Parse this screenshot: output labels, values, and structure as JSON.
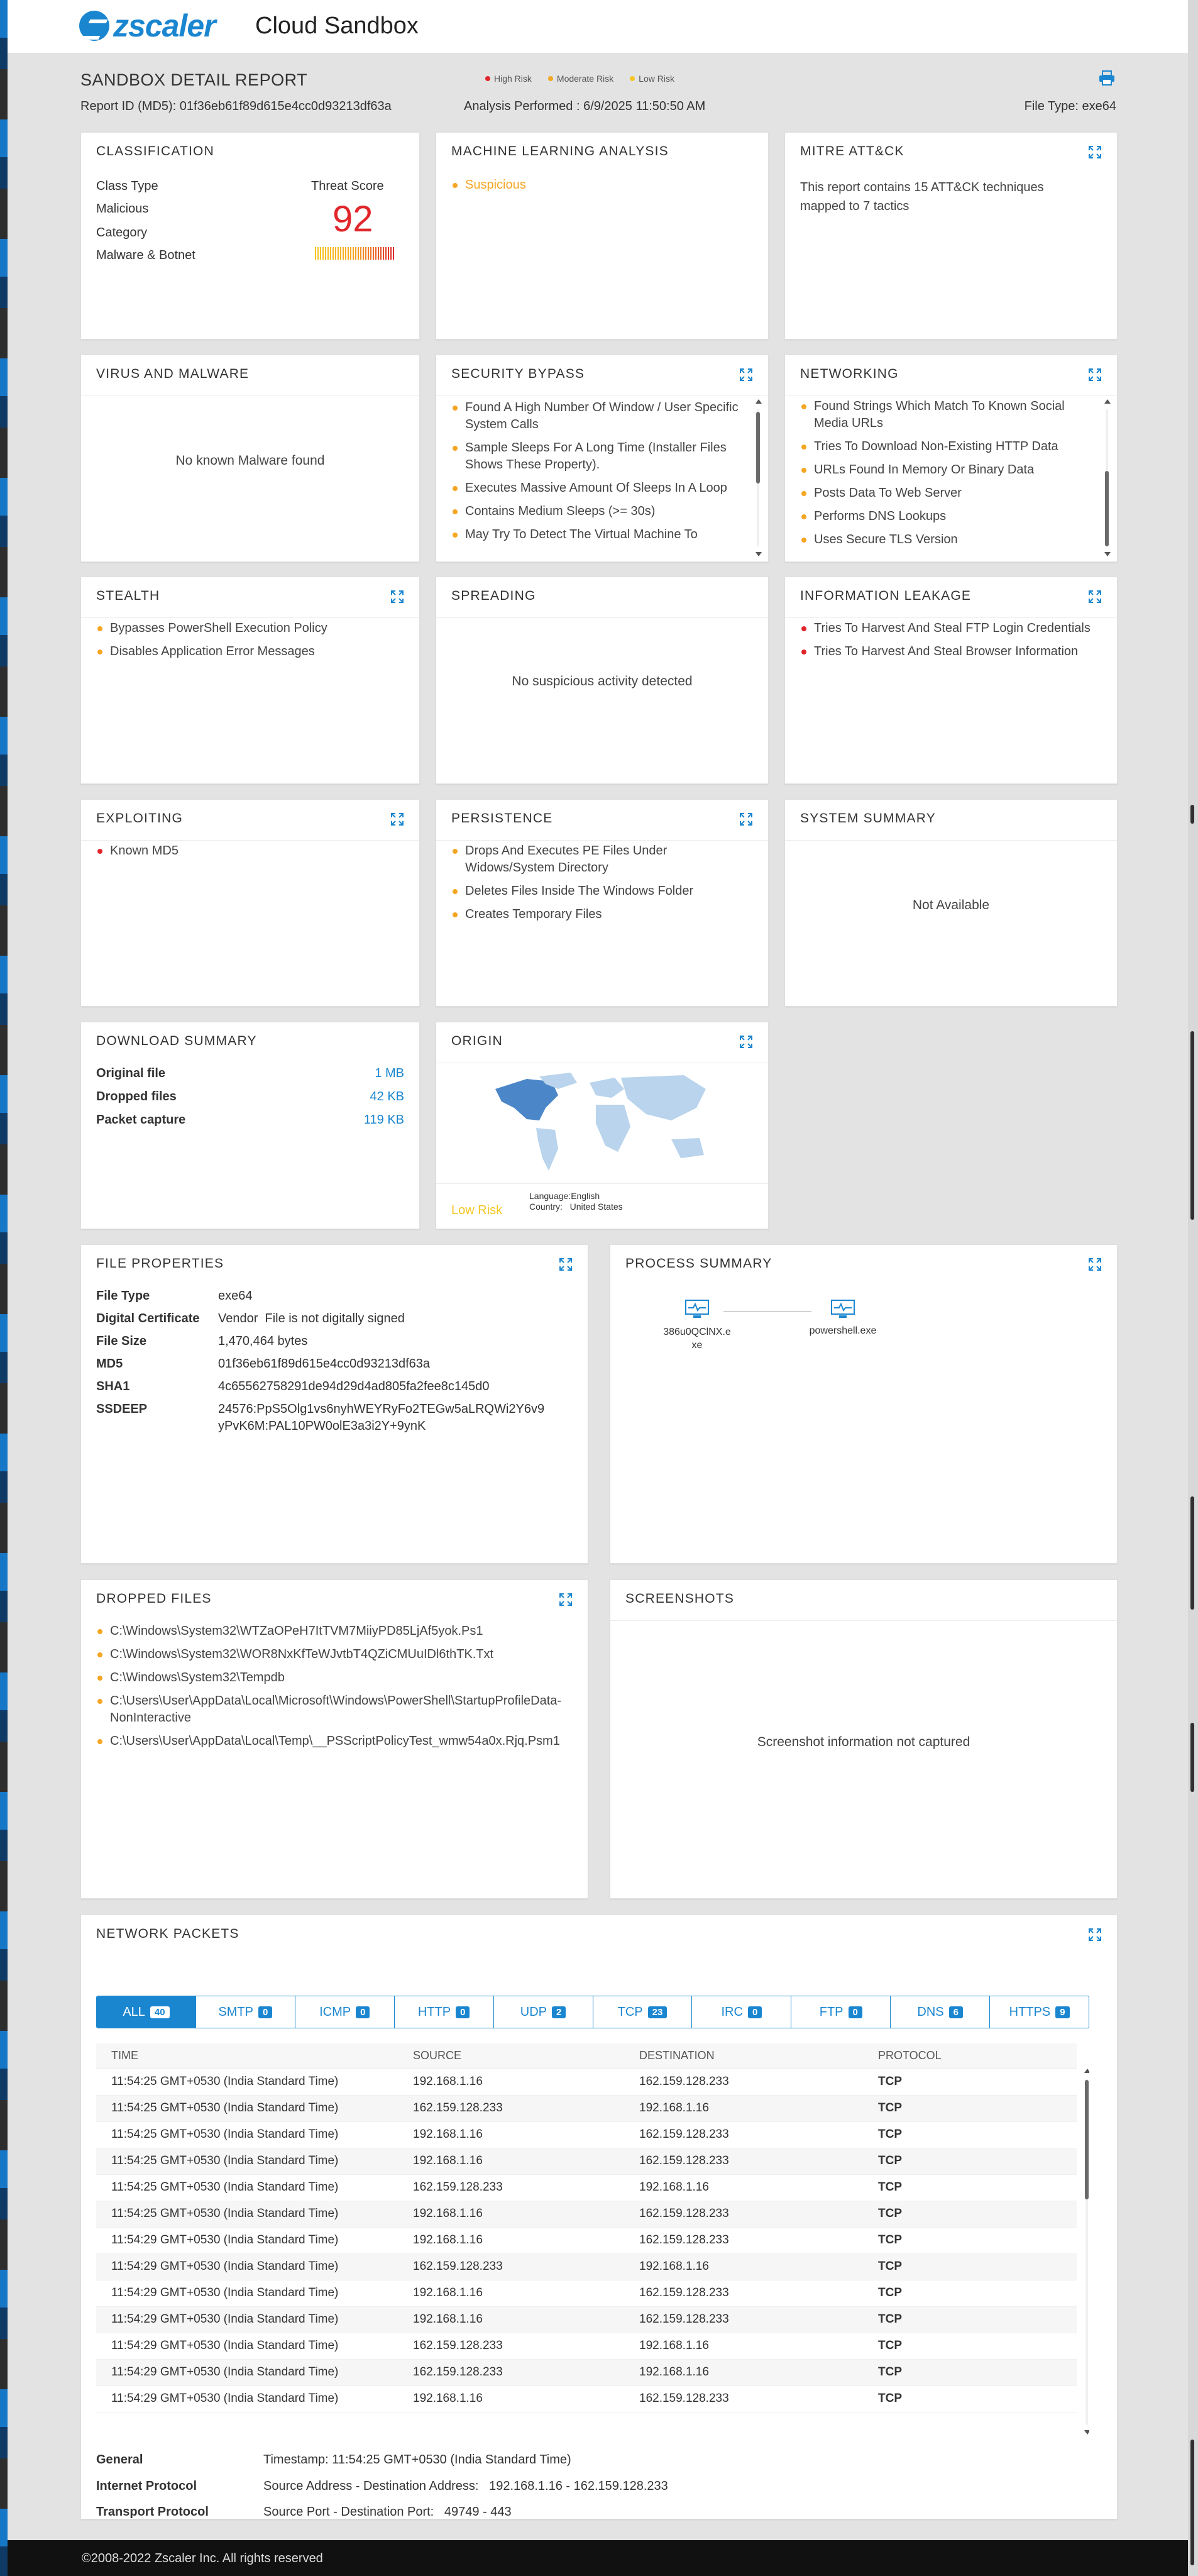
{
  "header": {
    "app_title": "Cloud Sandbox",
    "logo_text": "zscaler"
  },
  "report": {
    "title": "SANDBOX DETAIL REPORT",
    "report_id": "Report ID (MD5): 01f36eb61f89d615e4cc0d93213df63a",
    "analysis": "Analysis Performed : 6/9/2025 11:50:50 AM",
    "file_type": "File Type: exe64",
    "legend": [
      {
        "label": "High Risk",
        "color": "#e0262b"
      },
      {
        "label": "Moderate Risk",
        "color": "#f5a623"
      },
      {
        "label": "Low Risk",
        "color": "#f5c623"
      }
    ]
  },
  "classification": {
    "title": "CLASSIFICATION",
    "class_type_label": "Class Type",
    "class_type": "Malicious",
    "category_label": "Category",
    "category": "Malware & Botnet",
    "score_label": "Threat Score",
    "score": "92"
  },
  "ml": {
    "title": "MACHINE LEARNING ANALYSIS",
    "result": "Suspicious"
  },
  "mitre": {
    "title": "MITRE ATT&CK",
    "text": "This report contains 15 ATT&CK techniques mapped to 7 tactics"
  },
  "virus": {
    "title": "VIRUS AND MALWARE",
    "message": "No known Malware found"
  },
  "security_bypass": {
    "title": "SECURITY BYPASS",
    "items": [
      "Found A High Number Of Window / User Specific System Calls",
      "Sample Sleeps For A Long Time (Installer Files Shows These Property).",
      "Executes Massive Amount Of Sleeps In A Loop",
      "Contains Medium Sleeps (>= 30s)",
      "May Try To Detect The Virtual Machine To"
    ]
  },
  "networking": {
    "title": "NETWORKING",
    "items": [
      "Found Strings Which Match To Known Social Media URLs",
      "Tries To Download Non-Existing HTTP Data",
      "URLs Found In Memory Or Binary Data",
      "Posts Data To Web Server",
      "Performs DNS Lookups",
      "Uses Secure TLS Version"
    ]
  },
  "stealth": {
    "title": "STEALTH",
    "items": [
      "Bypasses PowerShell Execution Policy",
      "Disables Application Error Messages"
    ]
  },
  "spreading": {
    "title": "SPREADING",
    "message": "No suspicious activity detected"
  },
  "info_leak": {
    "title": "INFORMATION LEAKAGE",
    "items": [
      "Tries To Harvest And Steal FTP Login Credentials",
      "Tries To Harvest And Steal Browser Information"
    ]
  },
  "exploiting": {
    "title": "EXPLOITING",
    "items": [
      "Known MD5"
    ]
  },
  "persistence": {
    "title": "PERSISTENCE",
    "items": [
      "Drops And Executes PE Files Under Widows/System Directory",
      "Deletes Files Inside The Windows Folder",
      "Creates Temporary Files"
    ]
  },
  "system_summary": {
    "title": "SYSTEM SUMMARY",
    "message": "Not Available"
  },
  "download": {
    "title": "DOWNLOAD SUMMARY",
    "rows": [
      {
        "label": "Original file",
        "value": "1 MB"
      },
      {
        "label": "Dropped files",
        "value": "42 KB"
      },
      {
        "label": "Packet capture",
        "value": "119 KB"
      }
    ]
  },
  "origin": {
    "title": "ORIGIN",
    "risk": "Low Risk",
    "language_label": "Language:",
    "language": "English",
    "country_label": "Country:",
    "country": "United States"
  },
  "file_props": {
    "title": "FILE PROPERTIES",
    "rows": [
      {
        "label": "File Type",
        "value": "exe64"
      },
      {
        "label": "Digital Certificate",
        "value": "Vendor  File is not digitally signed"
      },
      {
        "label": "File Size",
        "value": "1,470,464 bytes"
      },
      {
        "label": "MD5",
        "value": "01f36eb61f89d615e4cc0d93213df63a"
      },
      {
        "label": "SHA1",
        "value": "4c65562758291de94d29d4ad805fa2fee8c145d0"
      },
      {
        "label": "SSDEEP",
        "value": "24576:PpS5Olg1vs6nyhWEYRyFo2TEGw5aLRQWi2Y6v9",
        "value2": "yPvK6M:PAL10PW0olE3a3i2Y+9ynK"
      }
    ]
  },
  "process": {
    "title": "PROCESS SUMMARY",
    "node1_a": "386u0QClNX.e",
    "node1_b": "xe",
    "node2": "powershell.exe"
  },
  "dropped": {
    "title": "DROPPED FILES",
    "items": [
      "C:\\Windows\\System32\\WTZaOPeH7ItTVM7MiiyPD85LjAf5yok.Ps1",
      "C:\\Windows\\System32\\WOR8NxKfTeWJvtbT4QZiCMUuIDl6thTK.Txt",
      "C:\\Windows\\System32\\Tempdb",
      "C:\\Users\\User\\AppData\\Local\\Microsoft\\Windows\\PowerShell\\StartupProfileData-NonInteractive",
      "C:\\Users\\User\\AppData\\Local\\Temp\\__PSScriptPolicyTest_wmw54a0x.Rjq.Psm1"
    ]
  },
  "screenshots": {
    "title": "SCREENSHOTS",
    "message": "Screenshot information not captured"
  },
  "packets": {
    "title": "NETWORK PACKETS",
    "tabs": [
      {
        "label": "ALL",
        "count": "40"
      },
      {
        "label": "SMTP",
        "count": "0"
      },
      {
        "label": "ICMP",
        "count": "0"
      },
      {
        "label": "HTTP",
        "count": "0"
      },
      {
        "label": "UDP",
        "count": "2"
      },
      {
        "label": "TCP",
        "count": "23"
      },
      {
        "label": "IRC",
        "count": "0"
      },
      {
        "label": "FTP",
        "count": "0"
      },
      {
        "label": "DNS",
        "count": "6"
      },
      {
        "label": "HTTPS",
        "count": "9"
      }
    ],
    "columns": [
      "TIME",
      "SOURCE",
      "DESTINATION",
      "PROTOCOL"
    ],
    "rows": [
      [
        "11:54:25 GMT+0530 (India Standard Time)",
        "192.168.1.16",
        "162.159.128.233",
        "TCP"
      ],
      [
        "11:54:25 GMT+0530 (India Standard Time)",
        "162.159.128.233",
        "192.168.1.16",
        "TCP"
      ],
      [
        "11:54:25 GMT+0530 (India Standard Time)",
        "192.168.1.16",
        "162.159.128.233",
        "TCP"
      ],
      [
        "11:54:25 GMT+0530 (India Standard Time)",
        "192.168.1.16",
        "162.159.128.233",
        "TCP"
      ],
      [
        "11:54:25 GMT+0530 (India Standard Time)",
        "162.159.128.233",
        "192.168.1.16",
        "TCP"
      ],
      [
        "11:54:25 GMT+0530 (India Standard Time)",
        "192.168.1.16",
        "162.159.128.233",
        "TCP"
      ],
      [
        "11:54:29 GMT+0530 (India Standard Time)",
        "192.168.1.16",
        "162.159.128.233",
        "TCP"
      ],
      [
        "11:54:29 GMT+0530 (India Standard Time)",
        "162.159.128.233",
        "192.168.1.16",
        "TCP"
      ],
      [
        "11:54:29 GMT+0530 (India Standard Time)",
        "192.168.1.16",
        "162.159.128.233",
        "TCP"
      ],
      [
        "11:54:29 GMT+0530 (India Standard Time)",
        "192.168.1.16",
        "162.159.128.233",
        "TCP"
      ],
      [
        "11:54:29 GMT+0530 (India Standard Time)",
        "162.159.128.233",
        "192.168.1.16",
        "TCP"
      ],
      [
        "11:54:29 GMT+0530 (India Standard Time)",
        "162.159.128.233",
        "192.168.1.16",
        "TCP"
      ],
      [
        "11:54:29 GMT+0530 (India Standard Time)",
        "192.168.1.16",
        "162.159.128.233",
        "TCP"
      ]
    ],
    "details": [
      {
        "label": "General",
        "value": "Timestamp: 11:54:25 GMT+0530 (India Standard Time)"
      },
      {
        "label": "Internet Protocol",
        "value": "Source Address - Destination Address:   192.168.1.16 - 162.159.128.233"
      },
      {
        "label": "Transport Protocol",
        "value": "Source Port - Destination Port:   49749 - 443"
      }
    ]
  },
  "footer": {
    "text": "©2008-2022 Zscaler Inc. All rights reserved"
  }
}
